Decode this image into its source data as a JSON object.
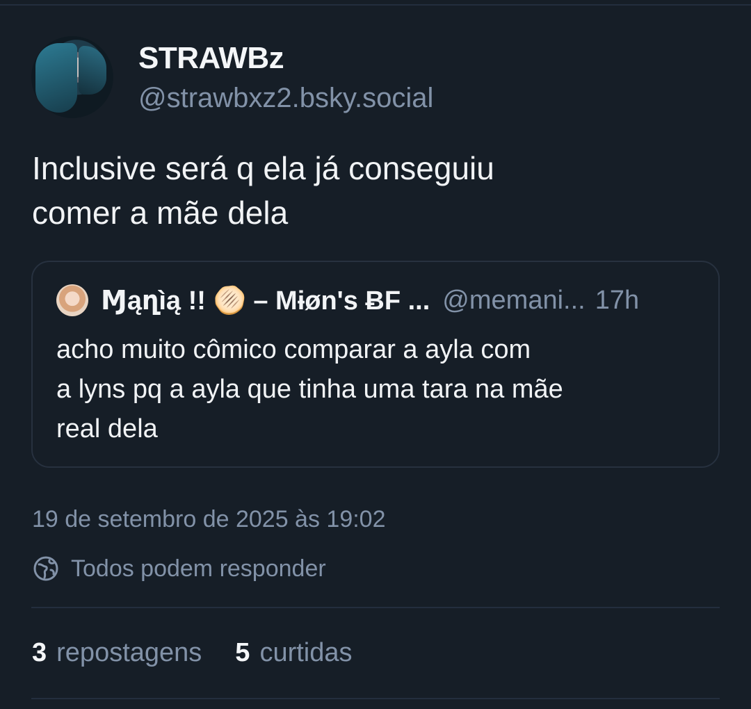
{
  "author": {
    "display_name": "STRAWBz",
    "handle": "@strawbxz2.bsky.social"
  },
  "post": {
    "text_line1": "Inclusive será q ela já conseguiu",
    "text_line2": "comer a mãe dela"
  },
  "quote": {
    "name": "Ɱąղìą !! 🫓 – Mɨøn's ɃF ...",
    "handle": "@memani...",
    "time": "17h",
    "text_line1": "acho muito cômico comparar a ayla com",
    "text_line2": "a lyns pq a ayla que tinha uma tara na mãe",
    "text_line3": "real dela"
  },
  "meta": {
    "timestamp": "19 de setembro de 2025 às 19:02",
    "reply_setting": "Todos podem responder",
    "reply_icon": "globe-icon"
  },
  "stats": {
    "reposts_count": "3",
    "reposts_label": "repostagens",
    "likes_count": "5",
    "likes_label": "curtidas"
  },
  "colors": {
    "background": "#161e27",
    "muted_text": "#8292a8",
    "border": "#27313f"
  }
}
